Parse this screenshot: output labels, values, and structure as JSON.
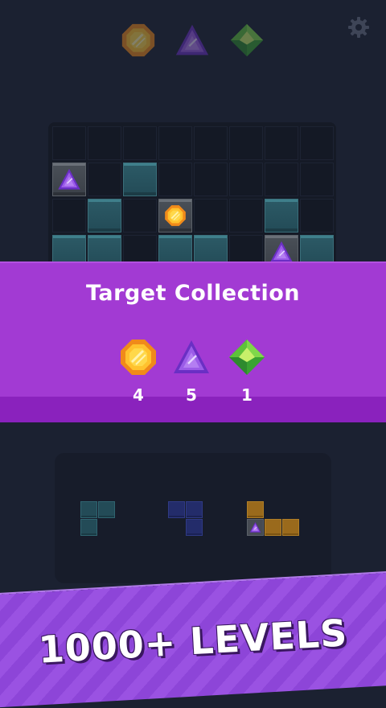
{
  "top_bar": {
    "gems": [
      "orange-gem-icon",
      "purple-triangle-gem-icon",
      "green-diamond-gem-icon"
    ],
    "settings_icon": "gear-icon"
  },
  "board": {
    "rows": 4,
    "cols": 8
  },
  "overlay": {
    "title": "Target Collection",
    "targets": [
      {
        "gem": "orange-gem-icon",
        "count": "4"
      },
      {
        "gem": "purple-triangle-gem-icon",
        "count": "5"
      },
      {
        "gem": "green-diamond-gem-icon",
        "count": "1"
      }
    ]
  },
  "tray": {
    "pieces": [
      "teal-l-piece",
      "navy-s-piece",
      "gold-l-piece"
    ]
  },
  "promo": {
    "text": "1000+ LEVELS"
  },
  "colors": {
    "background": "#1b2131",
    "banner": "#a23ad3",
    "teal_block": "#234b57",
    "ribbon": "#8d45d8"
  }
}
